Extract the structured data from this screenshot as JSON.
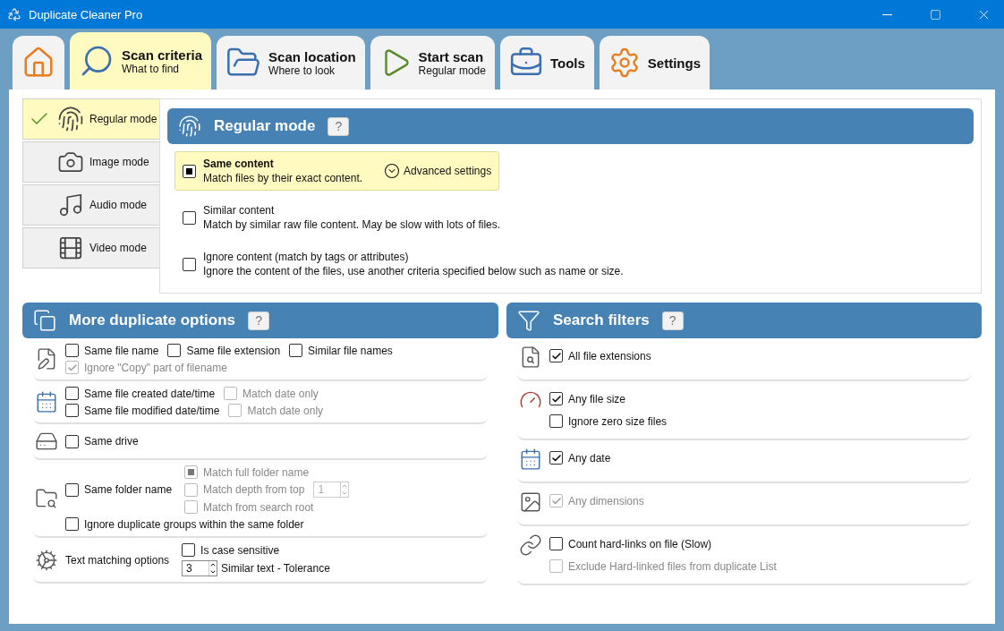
{
  "window": {
    "title": "Duplicate Cleaner Pro"
  },
  "tabs": [
    {
      "kind": "home",
      "selected": false
    },
    {
      "kind": "search",
      "title": "Scan criteria",
      "subtitle": "What to find",
      "selected": true
    },
    {
      "kind": "folder",
      "title": "Scan location",
      "subtitle": "Where to look",
      "selected": false
    },
    {
      "kind": "play",
      "title": "Start scan",
      "subtitle": "Regular mode",
      "selected": false
    },
    {
      "kind": "tools",
      "title": "Tools",
      "selected": false
    },
    {
      "kind": "settings",
      "title": "Settings",
      "selected": false
    }
  ],
  "modes": [
    {
      "kind": "fingerprint",
      "label": "Regular mode",
      "selected": true
    },
    {
      "kind": "camera",
      "label": "Image mode",
      "selected": false
    },
    {
      "kind": "music",
      "label": "Audio mode",
      "selected": false
    },
    {
      "kind": "film",
      "label": "Video mode",
      "selected": false
    }
  ],
  "regular_mode": {
    "title": "Regular mode",
    "help": "?",
    "options": [
      {
        "title": "Same content",
        "description": "Match files by their exact content.",
        "selected": true,
        "advanced_settings": "Advanced settings"
      },
      {
        "title": "Similar content",
        "description": "Match by similar raw file content. May be slow with lots of files.",
        "selected": false
      },
      {
        "title": "Ignore content (match by tags or attributes)",
        "description": "Ignore the content of the files, use another criteria specified below such as name or size.",
        "selected": false
      }
    ]
  },
  "more_options": {
    "title": "More duplicate options",
    "help": "?",
    "groups": [
      {
        "kind": "name",
        "rows": [
          [
            {
              "label": "Same file name",
              "checked": false,
              "disabled": false
            },
            {
              "label": "Same file extension",
              "checked": false,
              "disabled": false
            },
            {
              "label": "Similar file names",
              "checked": false,
              "disabled": false
            }
          ],
          [
            {
              "label": "Ignore \"Copy\" part of filename",
              "checked": true,
              "disabled": true
            }
          ]
        ]
      },
      {
        "kind": "date",
        "rows": [
          [
            {
              "label": "Same file created date/time",
              "checked": false,
              "disabled": false
            },
            {
              "label": "Match date only",
              "checked": false,
              "disabled": true
            }
          ],
          [
            {
              "label": "Same file modified date/time",
              "checked": false,
              "disabled": false
            },
            {
              "label": "Match date only",
              "checked": false,
              "disabled": true
            }
          ]
        ]
      },
      {
        "kind": "drive",
        "rows": [
          [
            {
              "label": "Same drive",
              "checked": false,
              "disabled": false
            }
          ]
        ]
      },
      {
        "kind": "folder",
        "main": {
          "label": "Same folder name",
          "checked": false,
          "disabled": false
        },
        "choices": [
          {
            "label": "Match full folder name",
            "selected": true,
            "disabled": true
          },
          {
            "label": "Match depth from top",
            "selected": false,
            "disabled": true,
            "spinner": "1"
          },
          {
            "label": "Match from search root",
            "selected": false,
            "disabled": true
          }
        ],
        "extra": {
          "label": "Ignore duplicate groups within the same folder",
          "checked": false,
          "disabled": false
        }
      },
      {
        "kind": "text",
        "label": "Text matching options",
        "case": {
          "label": "Is case sensitive",
          "checked": false,
          "disabled": false
        },
        "tolerance": {
          "value": "3",
          "label": "Similar text - Tolerance"
        }
      }
    ]
  },
  "search_filters": {
    "title": "Search filters",
    "help": "?",
    "groups": [
      {
        "kind": "extension",
        "items": [
          {
            "label": "All file extensions",
            "checked": true,
            "disabled": false
          }
        ]
      },
      {
        "kind": "size",
        "items": [
          {
            "label": "Any file size",
            "checked": true,
            "disabled": false
          },
          {
            "label": "Ignore zero size files",
            "checked": false,
            "disabled": false
          }
        ]
      },
      {
        "kind": "date",
        "items": [
          {
            "label": "Any date",
            "checked": true,
            "disabled": false
          }
        ]
      },
      {
        "kind": "dimensions",
        "items": [
          {
            "label": "Any dimensions",
            "checked": true,
            "disabled": true
          }
        ]
      },
      {
        "kind": "hardlink",
        "items": [
          {
            "label": "Count hard-links on file (Slow)",
            "checked": false,
            "disabled": false
          },
          {
            "label": "Exclude Hard-linked files from duplicate List",
            "checked": false,
            "disabled": true
          }
        ]
      }
    ]
  }
}
